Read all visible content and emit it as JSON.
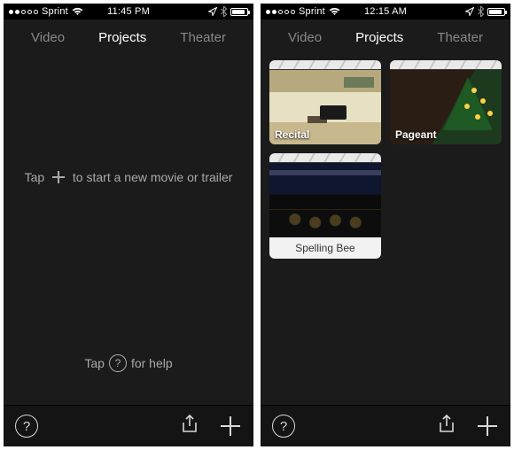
{
  "left": {
    "status": {
      "carrier": "Sprint",
      "time": "11:45 PM"
    },
    "tabs": {
      "video": "Video",
      "projects": "Projects",
      "theater": "Theater"
    },
    "empty": {
      "pre": "Tap",
      "post": "to start a new movie or trailer"
    },
    "help": {
      "pre": "Tap",
      "post": "for help"
    }
  },
  "right": {
    "status": {
      "carrier": "Sprint",
      "time": "12:15 AM"
    },
    "tabs": {
      "video": "Video",
      "projects": "Projects",
      "theater": "Theater"
    },
    "projects": [
      {
        "name": "Recital",
        "style": "overlay"
      },
      {
        "name": "Pageant",
        "style": "overlay"
      },
      {
        "name": "Spelling Bee",
        "style": "caption"
      }
    ]
  }
}
